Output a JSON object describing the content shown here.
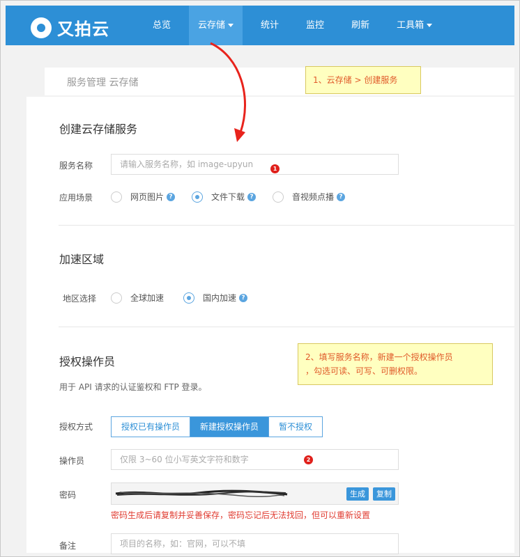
{
  "brand": {
    "name": "又拍云"
  },
  "nav": {
    "items": [
      {
        "label": "总览"
      },
      {
        "label": "云存储"
      },
      {
        "label": "统计"
      },
      {
        "label": "监控"
      },
      {
        "label": "刷新"
      },
      {
        "label": "工具箱"
      }
    ]
  },
  "breadcrumb": "服务管理 云存储",
  "form": {
    "title": "创建云存储服务",
    "service_name": {
      "label": "服务名称",
      "placeholder": "请输入服务名称，如 image-upyun"
    },
    "scenario": {
      "label": "应用场景",
      "options": [
        "网页图片",
        "文件下载",
        "音视频点播"
      ],
      "selected": "文件下载"
    },
    "region_section": {
      "title": "加速区域"
    },
    "region": {
      "label": "地区选择",
      "options": [
        "全球加速",
        "国内加速"
      ],
      "selected": "国内加速"
    },
    "operator_section": {
      "title": "授权操作员",
      "description": "用于 API 请求的认证鉴权和 FTP 登录。"
    },
    "auth_mode": {
      "label": "授权方式",
      "options": [
        "授权已有操作员",
        "新建授权操作员",
        "暂不授权"
      ],
      "selected": "新建授权操作员"
    },
    "operator": {
      "label": "操作员",
      "placeholder": "仅限 3~60 位小写英文字符和数字"
    },
    "password": {
      "label": "密码",
      "generate_label": "生成",
      "copy_label": "复制",
      "warning": "密码生成后请复制并妥善保存，密码忘记后无法找回，但可以重新设置"
    },
    "remark": {
      "label": "备注",
      "placeholder": "项目的名称，如：官网，可以不填"
    }
  },
  "annotations": {
    "step1": "1、云存储 > 创建服务",
    "step2_line1": "2、填写服务名称，新建一个授权操作员",
    "step2_line2": "，勾选可读、可写、可删权限。",
    "badge1": "1",
    "badge2": "2",
    "arrow_color": "#e8231c"
  },
  "colors": {
    "brand_blue": "#2d8fd6",
    "accent": "#5ba5e0",
    "warning": "#e03c31"
  }
}
